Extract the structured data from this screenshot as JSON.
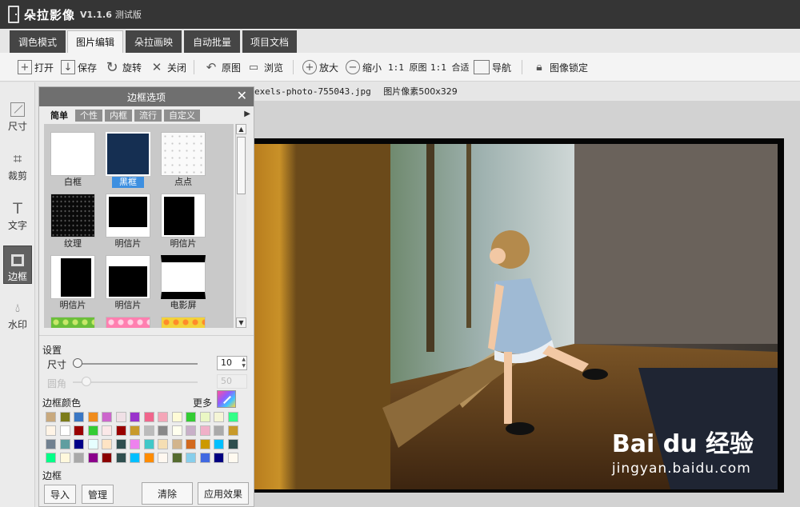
{
  "app": {
    "name": "朵拉影像",
    "version": "V1.1.6",
    "edition": "测试版"
  },
  "tabs": [
    {
      "label": "调色模式"
    },
    {
      "label": "图片编辑",
      "active": true
    },
    {
      "label": "朵拉画映"
    },
    {
      "label": "自动批量"
    },
    {
      "label": "项目文档"
    }
  ],
  "toolbar": {
    "open": "打开",
    "save": "保存",
    "rotate": "旋转",
    "close": "关闭",
    "original": "原图",
    "browse": "浏览",
    "zoom_in": "放大",
    "zoom_out": "缩小",
    "one_to_one": "1:1 原图",
    "fit": "1:1 合适",
    "navigator": "导航",
    "lock": "图像锁定"
  },
  "lefttools": [
    {
      "label": "尺寸",
      "icon": "resize-icon"
    },
    {
      "label": "裁剪",
      "icon": "crop-icon"
    },
    {
      "label": "文字",
      "icon": "text-icon"
    },
    {
      "label": "边框",
      "icon": "frame-icon",
      "active": true
    },
    {
      "label": "水印",
      "icon": "watermark-icon"
    }
  ],
  "file": {
    "name": "exels-photo-755043.jpg",
    "pixels": "图片像素500x329"
  },
  "panel": {
    "title": "边框选项",
    "frame_tabs": [
      "简单",
      "个性",
      "内框",
      "流行",
      "自定义"
    ],
    "active_frame_tab": "简单",
    "thumbnails": [
      {
        "label": "白框",
        "style": "white"
      },
      {
        "label": "黑框",
        "style": "navy",
        "selected": true
      },
      {
        "label": "点点",
        "style": "dots"
      },
      {
        "label": "纹理",
        "style": "texture"
      },
      {
        "label": "明信片",
        "style": "postcard-a"
      },
      {
        "label": "明信片",
        "style": "postcard-b"
      },
      {
        "label": "明信片",
        "style": "postcard-c"
      },
      {
        "label": "明信片",
        "style": "postcard-d"
      },
      {
        "label": "电影屏",
        "style": "cinema"
      }
    ],
    "settings_label": "设置",
    "size_label": "尺寸",
    "size_value": "10",
    "radius_label": "圆角",
    "radius_value": "50",
    "color_label": "边框颜色",
    "more_label": "更多",
    "border_label": "边框",
    "import": "导入",
    "manage": "管理",
    "clear": "清除",
    "apply": "应用效果",
    "swatches": [
      "#c8a97e",
      "#7c7c1a",
      "#3a77c4",
      "#f08c1c",
      "#cc66cc",
      "#f0e0e6",
      "#9a33cc",
      "#f0668c",
      "#f4a6b8",
      "#fffbd6",
      "#33cc33",
      "#eaf7c4",
      "#f5f5d6",
      "#33ff88",
      "#fff4e6",
      "#ffffff",
      "#990000",
      "#33cc33",
      "#fbe8e8",
      "#990000",
      "#c89a2a",
      "#bbbbbb",
      "#888888",
      "#ffffee",
      "#c8b0c8",
      "#f0b0c8",
      "#aaaaaa",
      "#c89a2a",
      "#708090",
      "#5f9ea0",
      "#000088",
      "#e6ffff",
      "#ffe4c4",
      "#2f4f4f",
      "#ee82ee",
      "#40c8c8",
      "#f5deb3",
      "#d2b48c",
      "#d2691e",
      "#cc9900",
      "#00bfff",
      "#2f4f4f",
      "#00ff88",
      "#fff8dc",
      "#a9a9a9",
      "#8b008b",
      "#8b0000",
      "#2f4f4f",
      "#00bfff",
      "#ff8c00",
      "#fff8f0",
      "#556b2f",
      "#87ceeb",
      "#4169e1",
      "#000080",
      "#fffaf0"
    ]
  },
  "watermark": {
    "main": "Bai du 经验",
    "sub": "jingyan.baidu.com"
  }
}
